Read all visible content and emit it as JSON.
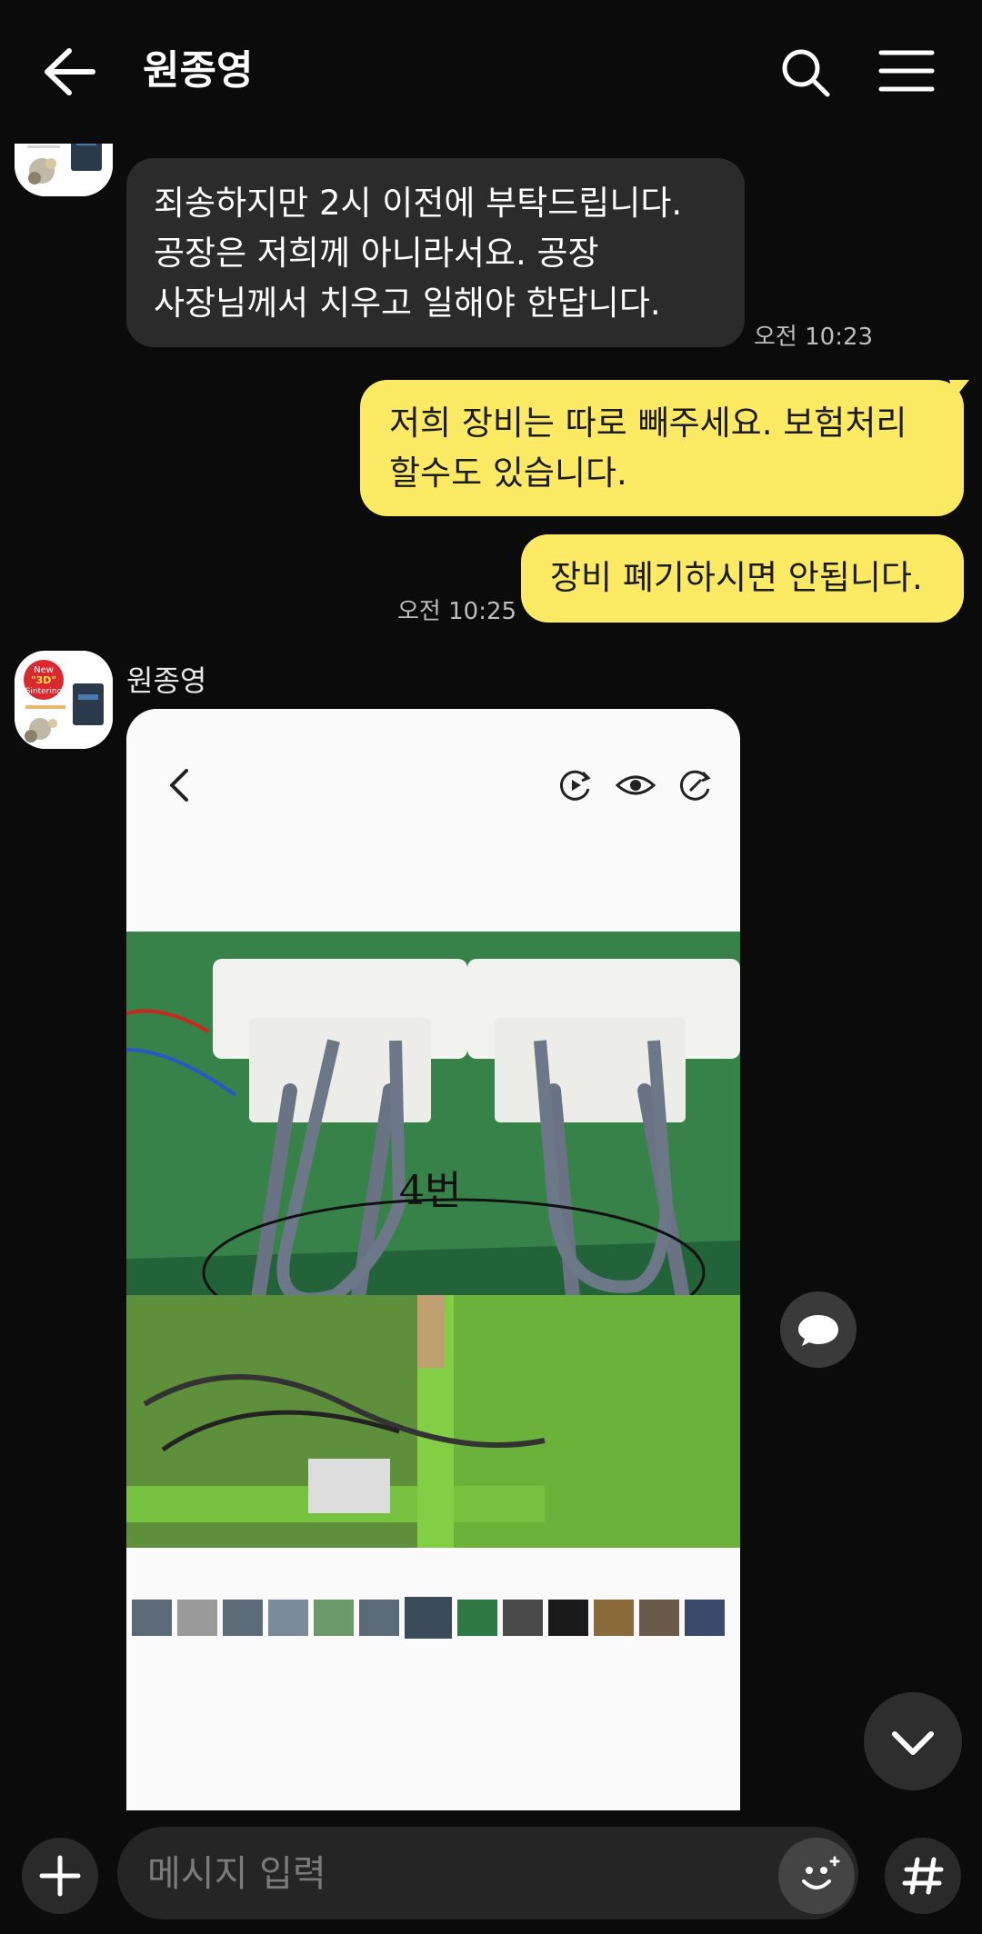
{
  "header": {
    "title": "원종영",
    "back_icon": "arrow-left-icon",
    "search_icon": "search-icon",
    "menu_icon": "hamburger-menu-icon"
  },
  "messages": {
    "m1": {
      "text_lines": [
        "죄송하지만 2시 이전에 부탁드립니다.",
        "공장은 저희께 아니라서요. 공장",
        "사장님께서 치우고 일해야 한답니다."
      ],
      "time": "오전 10:23"
    },
    "m2": {
      "text_lines": [
        "저희 장비는 따로 빼주세요. 보험처리",
        "할수도 있습니다."
      ]
    },
    "m3": {
      "text": "장비 폐기하시면 안됩니다.",
      "time": "오전 10:25"
    },
    "sender_name": "원종영"
  },
  "photo": {
    "handwriting": "4번"
  },
  "avatar": {
    "badge_new": "New",
    "badge_3d": "\"3D\"",
    "badge_sintering": "Sintering"
  },
  "input": {
    "placeholder": "메시지 입력"
  },
  "colors": {
    "background": "#0b0b0b",
    "incoming_bubble": "#2b2b2b",
    "outgoing_bubble": "#fdea64"
  }
}
